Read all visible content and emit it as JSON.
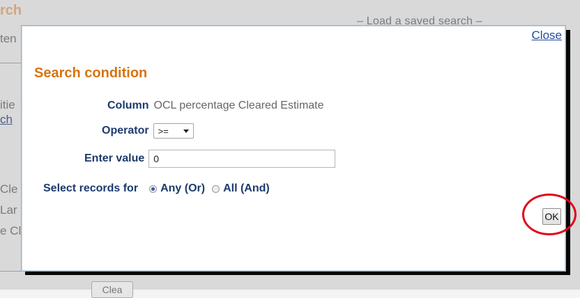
{
  "background": {
    "title_fragment": "rch",
    "left_fragments": [
      "ten",
      "itie",
      "ch",
      "Cle",
      "Lar",
      "e Cl"
    ],
    "saved_search_label": "– Load a saved search –",
    "button_fragment": "Clea"
  },
  "dialog": {
    "close_label": "Close",
    "title": "Search condition",
    "column_label": "Column",
    "column_value": "OCL percentage Cleared Estimate",
    "operator_label": "Operator",
    "operator_value": ">=",
    "enter_value_label": "Enter value",
    "enter_value": "0",
    "select_records_label": "Select records for",
    "options": [
      {
        "label": "Any (Or)",
        "checked": true
      },
      {
        "label": "All (And)",
        "checked": false
      }
    ],
    "ok_label": "OK"
  },
  "colors": {
    "title": "#d8730f",
    "label": "#1d3b6d",
    "link": "#1f4b99",
    "highlight": "#e2001a"
  }
}
